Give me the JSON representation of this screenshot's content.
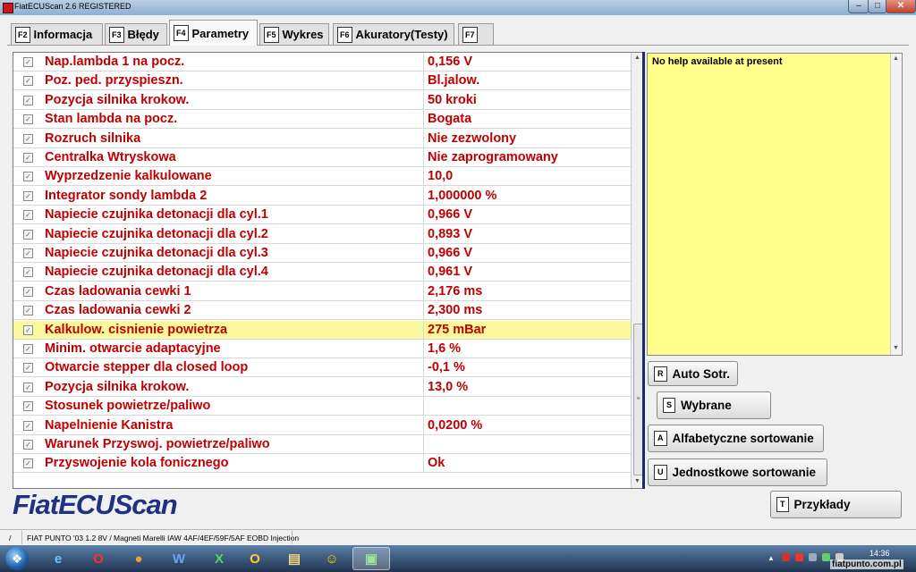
{
  "window": {
    "title": "FiatECUScan 2.6 REGISTERED"
  },
  "tabs": [
    {
      "key": "F2",
      "label": "Informacja"
    },
    {
      "key": "F3",
      "label": "Błędy"
    },
    {
      "key": "F4",
      "label": "Parametry",
      "active": true
    },
    {
      "key": "F5",
      "label": "Wykres"
    },
    {
      "key": "F6",
      "label": "Akuratory(Testy)"
    },
    {
      "key": "F7",
      "label": ""
    }
  ],
  "params": [
    {
      "name": "Nap.lambda 1 na pocz.",
      "value": "0,156 V"
    },
    {
      "name": "Poz. ped. przyspieszn.",
      "value": "Bl.jalow."
    },
    {
      "name": "Pozycja silnika krokow.",
      "value": "50 kroki"
    },
    {
      "name": "Stan lambda na pocz.",
      "value": "Bogata"
    },
    {
      "name": "Rozruch silnika",
      "value": "Nie zezwolony"
    },
    {
      "name": "Centralka Wtryskowa",
      "value": "Nie zaprogramowany"
    },
    {
      "name": "Wyprzedzenie kalkulowane",
      "value": "10,0"
    },
    {
      "name": "Integrator sondy lambda 2",
      "value": "1,000000 %"
    },
    {
      "name": "Napiecie czujnika detonacji dla cyl.1",
      "value": "0,966 V"
    },
    {
      "name": "Napiecie czujnika detonacji dla cyl.2",
      "value": "0,893 V"
    },
    {
      "name": "Napiecie czujnika detonacji dla cyl.3",
      "value": "0,966 V"
    },
    {
      "name": "Napiecie czujnika detonacji dla cyl.4",
      "value": "0,961 V"
    },
    {
      "name": "Czas ladowania cewki 1",
      "value": "2,176 ms"
    },
    {
      "name": "Czas ladowania cewki 2",
      "value": "2,300 ms"
    },
    {
      "name": "Kalkulow. cisnienie powietrza",
      "value": "275 mBar",
      "highlighted": true
    },
    {
      "name": "Minim. otwarcie adaptacyjne",
      "value": "1,6 %"
    },
    {
      "name": "Otwarcie stepper dla closed loop",
      "value": "-0,1 %"
    },
    {
      "name": "Pozycja silnika krokow.",
      "value": "13,0 %"
    },
    {
      "name": "Stosunek powietrze/paliwo",
      "value": ""
    },
    {
      "name": "Napelnienie Kanistra",
      "value": "0,0200 %"
    },
    {
      "name": "Warunek Przyswoj. powietrze/paliwo",
      "value": ""
    },
    {
      "name": "Przyswojenie kola fonicznego",
      "value": "Ok"
    }
  ],
  "help": {
    "text": "No help available at present"
  },
  "buttons": {
    "auto_sort": {
      "key": "R",
      "label": "Auto Sotr."
    },
    "selected": {
      "key": "S",
      "label": "Wybrane"
    },
    "alpha_sort": {
      "key": "A",
      "label": "Alfabetyczne sortowanie"
    },
    "unit_sort": {
      "key": "U",
      "label": "Jednostkowe sortowanie"
    },
    "examples": {
      "key": "T",
      "label": "Przykłady"
    }
  },
  "logo": "FiatECUScan",
  "status": {
    "left": "/",
    "vehicle": "FIAT PUNTO '03 1.2 8V / Magneti Marelli IAW 4AF/4EF/59F/5AF EOBD Injection"
  },
  "taskbar": {
    "clock": "14:36",
    "watermark": "fiatpunto.com.pl",
    "apps": [
      "internet-explorer",
      "opera",
      "firefox",
      "word",
      "excel",
      "outlook",
      "explorer",
      "game",
      "fiatecuscan"
    ]
  }
}
